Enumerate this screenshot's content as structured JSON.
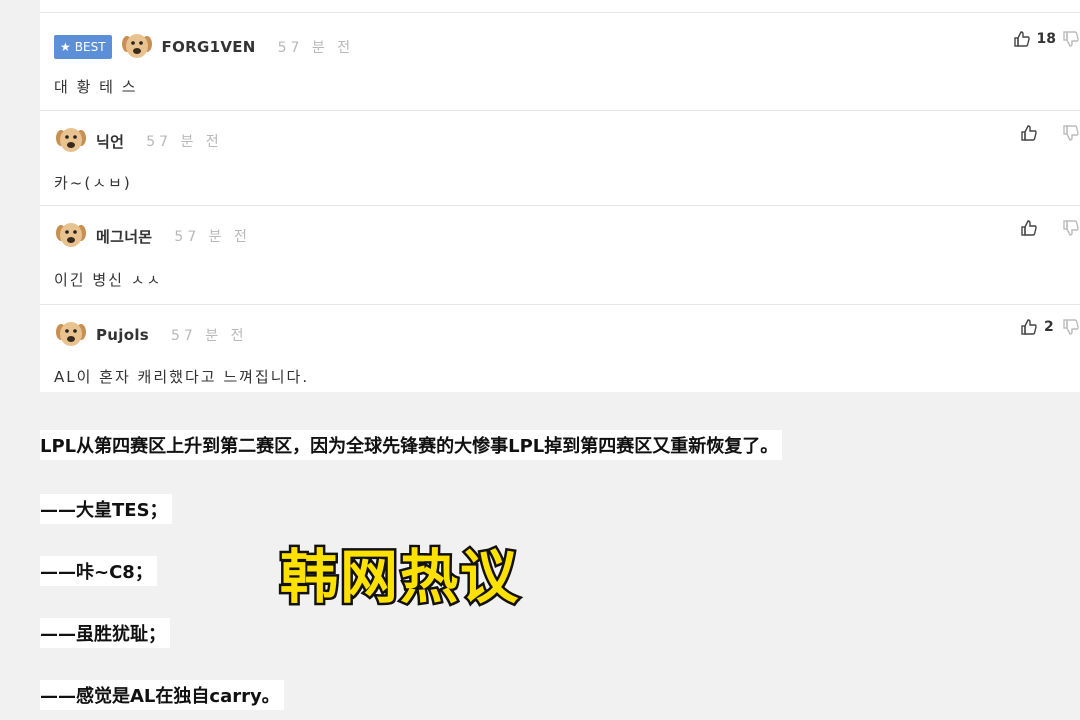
{
  "comments": [
    {
      "badge": "BEST",
      "author": "FORG1VEN",
      "time": "57 분 전",
      "body": "대 황 테 스",
      "likes": "18"
    },
    {
      "author": "닉언",
      "time": "57 분 전",
      "body": "카~(ㅅㅂ)",
      "likes": ""
    },
    {
      "author": "메그너몬",
      "time": "57 분 전",
      "body": "이긴 병신 ㅅㅅ",
      "likes": ""
    },
    {
      "author": "Pujols",
      "time": "57 분 전",
      "body": "AL이 혼자 캐리했다고 느껴집니다.",
      "likes": "2"
    }
  ],
  "article": {
    "lines": [
      "LPL从第四赛区上升到第二赛区，因为全球先锋赛的大惨事LPL掉到第四赛区又重新恢复了。",
      "——大皇TES；",
      "——咔~C8；",
      "——虽胜犹耻；",
      "——感觉是AL在独自carry。"
    ]
  },
  "overlay": {
    "title": "韩网热议"
  },
  "icons": {
    "avatar": "puppy-avatar-icon",
    "like": "thumbs-up-icon",
    "dislike": "thumbs-down-icon",
    "best": "star-icon"
  },
  "colors": {
    "badge": "#5b8fd7",
    "overlay_fill": "#ffe100",
    "overlay_stroke": "#111111",
    "time": "#b8b8b8"
  }
}
